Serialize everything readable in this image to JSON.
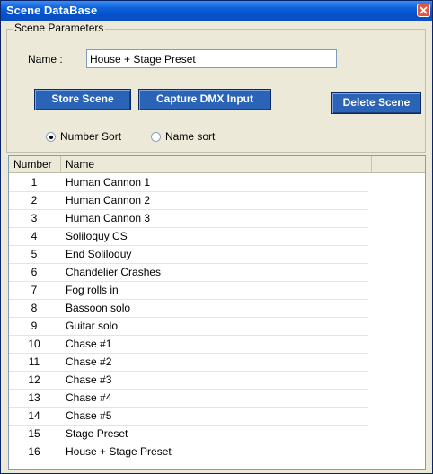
{
  "window": {
    "title": "Scene DataBase"
  },
  "params": {
    "group_label": "Scene Parameters",
    "name_label": "Name :",
    "name_value": "House + Stage Preset"
  },
  "buttons": {
    "store": "Store Scene",
    "capture": "Capture DMX Input",
    "delete": "Delete Scene"
  },
  "sort": {
    "number_label": "Number Sort",
    "name_label": "Name sort",
    "selected": "Number Sort"
  },
  "list": {
    "columns": [
      "Number",
      "Name"
    ],
    "rows": [
      {
        "number": "1",
        "name": "Human Cannon 1"
      },
      {
        "number": "2",
        "name": "Human Cannon 2"
      },
      {
        "number": "3",
        "name": "Human Cannon 3"
      },
      {
        "number": "4",
        "name": "Soliloquy CS"
      },
      {
        "number": "5",
        "name": "End Soliloquy"
      },
      {
        "number": "6",
        "name": "Chandelier Crashes"
      },
      {
        "number": "7",
        "name": "Fog rolls in"
      },
      {
        "number": "8",
        "name": "Bassoon solo"
      },
      {
        "number": "9",
        "name": "Guitar solo"
      },
      {
        "number": "10",
        "name": "Chase #1"
      },
      {
        "number": "11",
        "name": "Chase #2"
      },
      {
        "number": "12",
        "name": "Chase #3"
      },
      {
        "number": "13",
        "name": "Chase #4"
      },
      {
        "number": "14",
        "name": "Chase #5"
      },
      {
        "number": "15",
        "name": "Stage Preset"
      },
      {
        "number": "16",
        "name": "House + Stage Preset"
      }
    ]
  },
  "colors": {
    "titlebar": "#0651c9",
    "button": "#2b63b6",
    "close": "#e2553e"
  },
  "icons": {
    "close": "close-icon"
  }
}
